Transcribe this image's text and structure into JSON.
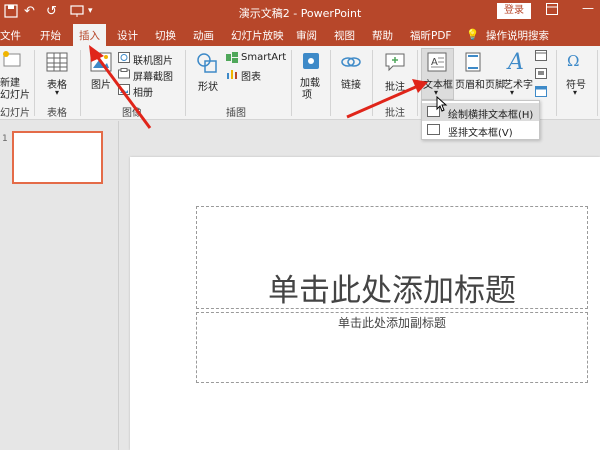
{
  "window": {
    "title": "演示文稿2  -  PowerPoint",
    "login_label": "登录",
    "restore_icon": "restore-icon",
    "minimize_icon": "minimize-icon"
  },
  "qat": {
    "save_icon": "save-icon",
    "undo_icon": "undo-icon",
    "redo_icon": "redo-icon",
    "start_icon": "start-from-beginning-icon"
  },
  "tabs": [
    {
      "label": "文件",
      "active": false
    },
    {
      "label": "开始",
      "active": false
    },
    {
      "label": "插入",
      "active": true
    },
    {
      "label": "设计",
      "active": false
    },
    {
      "label": "切换",
      "active": false
    },
    {
      "label": "动画",
      "active": false
    },
    {
      "label": "幻灯片放映",
      "active": false
    },
    {
      "label": "审阅",
      "active": false
    },
    {
      "label": "视图",
      "active": false
    },
    {
      "label": "帮助",
      "active": false
    },
    {
      "label": "福昕PDF",
      "active": false
    },
    {
      "label": "操作说明搜索",
      "active": false
    }
  ],
  "ribbon": {
    "new_slide": {
      "line1": "新建",
      "line2": "幻灯片"
    },
    "table": "表格",
    "picture": "图片",
    "online_picture": "联机图片",
    "screenshot": "屏幕截图",
    "album": "相册",
    "shapes": "形状",
    "smartart": "SmartArt",
    "chart": "图表",
    "addins": {
      "line1": "加载",
      "line2": "项"
    },
    "link": "链接",
    "comment": "批注",
    "textbox": "文本框",
    "header_footer": "页眉和页脚",
    "wordart": "艺术字",
    "symbols": "符号",
    "groups": {
      "slides": "幻灯片",
      "tables": "表格",
      "images": "图像",
      "illustrations": "插图",
      "comments": "批注"
    }
  },
  "textbox_menu": {
    "items": [
      "绘制横排文本框(H)",
      "竖排文本框(V)"
    ]
  },
  "slide": {
    "title_placeholder": "单击此处添加标题",
    "subtitle_placeholder": "单击此处添加副标题",
    "number": "1"
  },
  "colors": {
    "accent": "#b7472a",
    "arrow": "#e0251a"
  }
}
